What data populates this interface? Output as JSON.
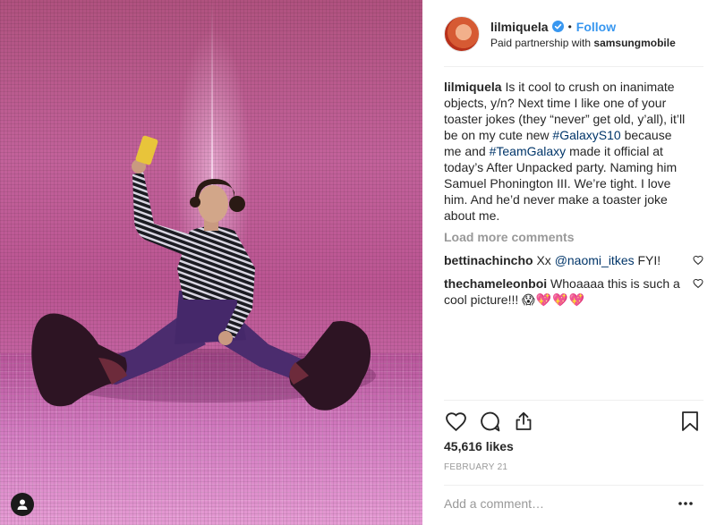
{
  "post": {
    "username": "lilmiquela",
    "verified_icon": "verified-badge-icon",
    "follow_label": "Follow",
    "separator": "•",
    "partnership_prefix": "Paid partnership with",
    "partner": "samsungmobile"
  },
  "caption": {
    "user": "lilmiquela",
    "text_1": " Is it cool to crush on inanimate objects, y/n? Next time I like one of your toaster jokes (they “never” get old, y’all), it’ll be on my cute new ",
    "tag_1": "#GalaxyS10",
    "text_2": " because me and ",
    "tag_2": "#TeamGalaxy",
    "text_3": " made it official at today’s After Unpacked party. Naming him Samuel Phonington III. We’re tight. I love him. And he’d never make a toaster joke about me."
  },
  "load_more_label": "Load more comments",
  "comments": [
    {
      "user": "bettinachincho",
      "text_before": " Xx ",
      "mention": "@naomi_itkes",
      "text_after": " FYI!"
    },
    {
      "user": "thechameleonboi",
      "text": " Whoaaaa this is such a cool picture!!! ",
      "emoji": "😱💖💖💖"
    }
  ],
  "actions": {
    "like_icon": "heart-icon",
    "comment_icon": "comment-icon",
    "share_icon": "share-icon",
    "save_icon": "bookmark-icon"
  },
  "likes": "45,616 likes",
  "date": "FEBRUARY 21",
  "add_comment_placeholder": "Add a comment…",
  "more_options_icon": "more-options-icon",
  "colors": {
    "link_blue": "#3897f0",
    "hashtag": "#003569",
    "muted": "#999999",
    "text": "#262626"
  }
}
